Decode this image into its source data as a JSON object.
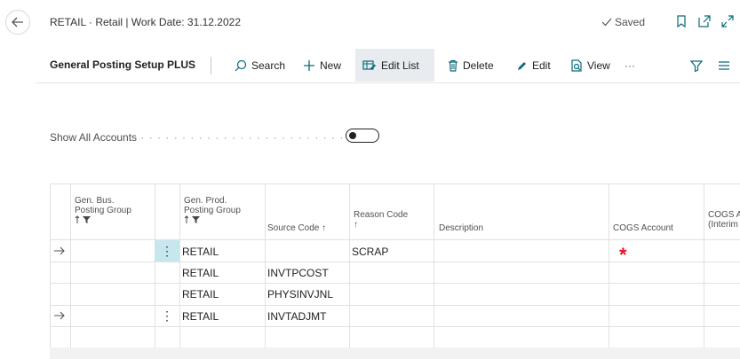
{
  "header": {
    "title": "RETAIL · Retail | Work Date: 31.12.2022",
    "saved_label": "Saved"
  },
  "actionbar": {
    "page_name": "General Posting Setup PLUS",
    "search": "Search",
    "new": "New",
    "edit_list": "Edit List",
    "delete": "Delete",
    "edit": "Edit",
    "view": "View",
    "more": "···"
  },
  "filter": {
    "show_all_label": "Show All Accounts",
    "show_all_value": false
  },
  "grid": {
    "columns": {
      "gen_bus": {
        "line1": "Gen. Bus.",
        "line2": "Posting Group"
      },
      "gen_prod": {
        "line1": "Gen. Prod.",
        "line2": "Posting Group"
      },
      "source_code": "Source Code ↑",
      "reason_code": {
        "line1": "Reason Code",
        "line2": "↑"
      },
      "description": "Description",
      "cogs_account": "COGS Account",
      "cogs_interim": {
        "line1": "COGS A",
        "line2": "(Interim"
      }
    },
    "rows": [
      {
        "gen_bus": "",
        "gen_prod": "RETAIL",
        "source_code": "",
        "reason_code": "SCRAP",
        "description": "",
        "cogs_account": "*"
      },
      {
        "gen_bus": "",
        "gen_prod": "RETAIL",
        "source_code": "INVTPCOST",
        "reason_code": "",
        "description": "",
        "cogs_account": ""
      },
      {
        "gen_bus": "",
        "gen_prod": "RETAIL",
        "source_code": "PHYSINVJNL",
        "reason_code": "",
        "description": "",
        "cogs_account": ""
      },
      {
        "gen_bus": "",
        "gen_prod": "RETAIL",
        "source_code": "INVTADJMT",
        "reason_code": "",
        "description": "",
        "cogs_account": ""
      },
      {
        "gen_bus": "",
        "gen_prod": "",
        "source_code": "",
        "reason_code": "",
        "description": "",
        "cogs_account": ""
      }
    ]
  },
  "icons": [
    "back-arrow-icon",
    "check-icon",
    "bookmark-icon",
    "open-new-window-icon",
    "expand-icon",
    "search-icon",
    "plus-icon",
    "edit-list-icon",
    "delete-icon",
    "edit-pencil-icon",
    "view-icon",
    "filter-icon",
    "list-icon",
    "sort-up-icon",
    "filter-funnel-icon",
    "row-arrow-icon",
    "row-actions-icon"
  ],
  "colors": {
    "accent": "#0a6a7a",
    "selected_cell": "#c7e7ee",
    "required": "#e81123",
    "active_action": "#e8ebef"
  }
}
